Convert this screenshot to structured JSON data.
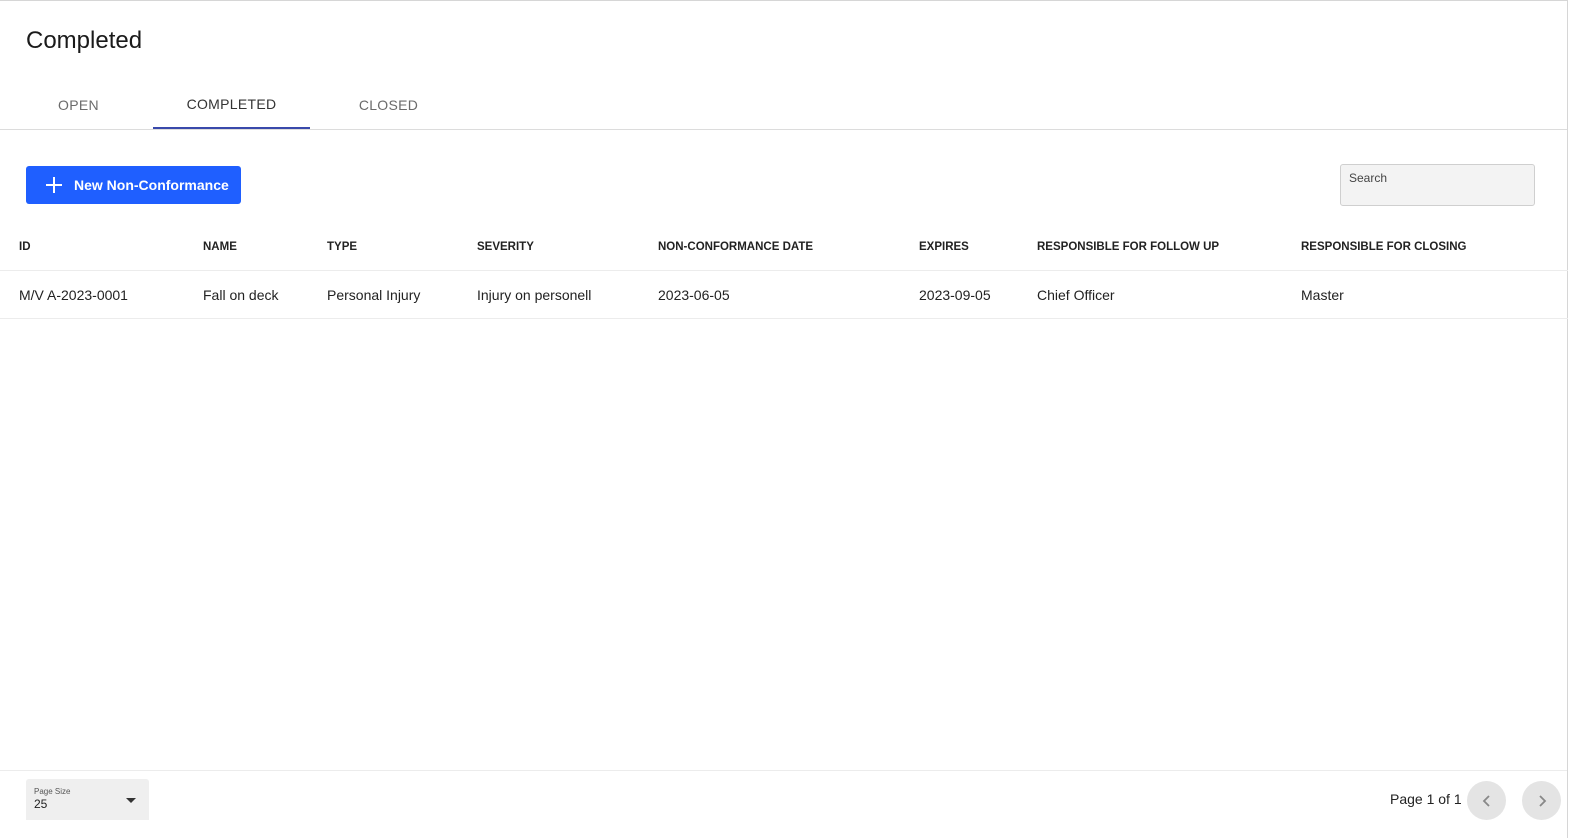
{
  "header": {
    "title": "Completed"
  },
  "tabs": [
    {
      "label": "OPEN",
      "active": false
    },
    {
      "label": "COMPLETED",
      "active": true
    },
    {
      "label": "CLOSED",
      "active": false
    }
  ],
  "toolbar": {
    "new_button_label": "New Non-Conformance",
    "new_button_icon": "plus-icon",
    "search_placeholder": "Search"
  },
  "table": {
    "columns": [
      "ID",
      "NAME",
      "TYPE",
      "SEVERITY",
      "NON-CONFORMANCE DATE",
      "EXPIRES",
      "RESPONSIBLE FOR FOLLOW UP",
      "RESPONSIBLE FOR CLOSING"
    ],
    "rows": [
      [
        "M/V A-2023-0001",
        "Fall on deck",
        "Personal Injury",
        "Injury on personell",
        "2023-06-05",
        "2023-09-05",
        "Chief Officer",
        "Master"
      ]
    ]
  },
  "footer": {
    "page_size_label": "Page Size",
    "page_size_value": "25",
    "page_info": "Page 1 of 1"
  },
  "colors": {
    "accent": "#1f5fff",
    "tab_indicator": "#3949ab"
  }
}
